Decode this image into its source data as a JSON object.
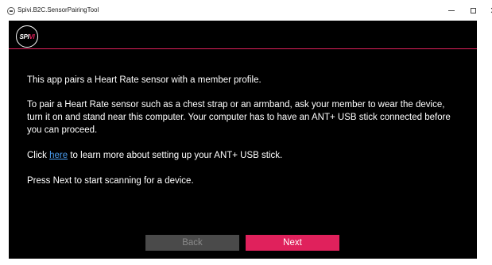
{
  "window": {
    "title": "Spivi.B2C.SensorPairingTool",
    "minimize_label": "–",
    "maximize_label": "☐",
    "close_label": "✕"
  },
  "logo": {
    "text_main": "SPI",
    "text_accent": "VI"
  },
  "content": {
    "paragraph1": "This app pairs a Heart Rate sensor with a member profile.",
    "paragraph2": "To pair a Heart Rate sensor such as a chest strap or an armband, ask your member to wear the device, turn it on and stand near this computer. Your computer has to have an ANT+ USB stick connected before you can proceed.",
    "paragraph3_prefix": "Click ",
    "paragraph3_link": "here",
    "paragraph3_suffix": " to learn more about setting up your ANT+ USB stick.",
    "paragraph4": "Press Next to start scanning for a device."
  },
  "buttons": {
    "back_label": "Back",
    "next_label": "Next"
  },
  "colors": {
    "accent": "#e0215c",
    "background": "#000000",
    "link": "#4a9df0",
    "disabled_button": "#4a4a4a"
  },
  "icons": {
    "app": "app-icon",
    "minimize": "minimize-icon",
    "maximize": "maximize-icon",
    "close": "close-icon"
  }
}
